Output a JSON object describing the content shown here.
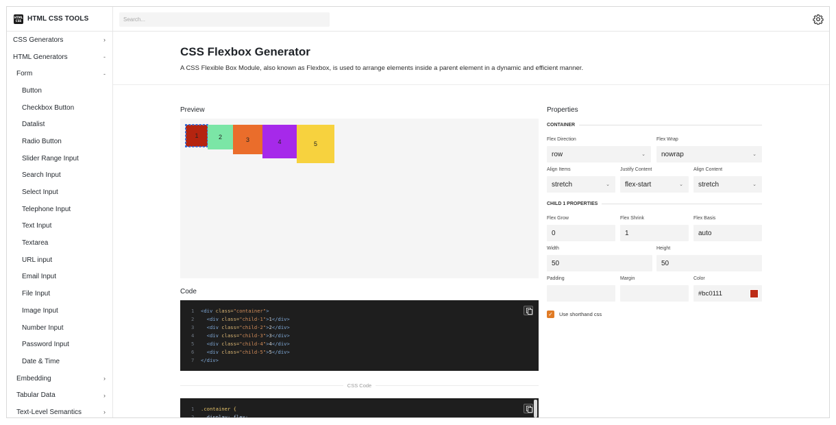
{
  "app": {
    "logo_badge": "HTML CSS",
    "logo_text": "HTML CSS TOOLS"
  },
  "search": {
    "placeholder": "Search..."
  },
  "icons": {
    "settings": "gear-icon",
    "copy": "copy-icon",
    "chevron": "chevron-down-icon",
    "check": "check-icon"
  },
  "sidebar": {
    "items": [
      {
        "label": "CSS Generators",
        "mark": "›",
        "level": 0
      },
      {
        "label": "HTML Generators",
        "mark": "-",
        "level": 0
      },
      {
        "label": "Form",
        "mark": "-",
        "level": 1
      },
      {
        "label": "Button",
        "mark": "",
        "level": 2
      },
      {
        "label": "Checkbox Button",
        "mark": "",
        "level": 2
      },
      {
        "label": "Datalist",
        "mark": "",
        "level": 2
      },
      {
        "label": "Radio Button",
        "mark": "",
        "level": 2
      },
      {
        "label": "Slider Range Input",
        "mark": "",
        "level": 2
      },
      {
        "label": "Search Input",
        "mark": "",
        "level": 2
      },
      {
        "label": "Select Input",
        "mark": "",
        "level": 2
      },
      {
        "label": "Telephone Input",
        "mark": "",
        "level": 2
      },
      {
        "label": "Text Input",
        "mark": "",
        "level": 2
      },
      {
        "label": "Textarea",
        "mark": "",
        "level": 2
      },
      {
        "label": "URL input",
        "mark": "",
        "level": 2
      },
      {
        "label": "Email Input",
        "mark": "",
        "level": 2
      },
      {
        "label": "File Input",
        "mark": "",
        "level": 2
      },
      {
        "label": "Image Input",
        "mark": "",
        "level": 2
      },
      {
        "label": "Number Input",
        "mark": "",
        "level": 2
      },
      {
        "label": "Password Input",
        "mark": "",
        "level": 2
      },
      {
        "label": "Date & Time",
        "mark": "",
        "level": 2
      },
      {
        "label": "Embedding",
        "mark": "›",
        "level": 1
      },
      {
        "label": "Tabular Data",
        "mark": "›",
        "level": 1
      },
      {
        "label": "Text-Level Semantics",
        "mark": "›",
        "level": 1
      }
    ]
  },
  "header": {
    "title": "CSS Flexbox Generator",
    "subtitle": "A CSS Flexible Box Module, also known as Flexbox, is used to arrange elements inside a parent element in a dynamic and efficient manner."
  },
  "preview": {
    "label": "Preview",
    "children": [
      "1",
      "2",
      "3",
      "4",
      "5"
    ]
  },
  "code": {
    "label": "Code",
    "html_lines": [
      {
        "n": "1",
        "indent": "",
        "open": "<div ",
        "attr": "class=",
        "val": "\"container\"",
        "close": ">",
        "text": "",
        "end": ""
      },
      {
        "n": "2",
        "indent": "  ",
        "open": "<div ",
        "attr": "class=",
        "val": "\"child-1\"",
        "close": ">",
        "text": "1",
        "end": "</div>"
      },
      {
        "n": "3",
        "indent": "  ",
        "open": "<div ",
        "attr": "class=",
        "val": "\"child-2\"",
        "close": ">",
        "text": "2",
        "end": "</div>"
      },
      {
        "n": "4",
        "indent": "  ",
        "open": "<div ",
        "attr": "class=",
        "val": "\"child-3\"",
        "close": ">",
        "text": "3",
        "end": "</div>"
      },
      {
        "n": "5",
        "indent": "  ",
        "open": "<div ",
        "attr": "class=",
        "val": "\"child-4\"",
        "close": ">",
        "text": "4",
        "end": "</div>"
      },
      {
        "n": "6",
        "indent": "  ",
        "open": "<div ",
        "attr": "class=",
        "val": "\"child-5\"",
        "close": ">",
        "text": "5",
        "end": "</div>"
      },
      {
        "n": "7",
        "indent": "",
        "open": "</div>",
        "attr": "",
        "val": "",
        "close": "",
        "text": "",
        "end": ""
      }
    ],
    "css_divider": "CSS Code",
    "css_lines": [
      {
        "n": "1",
        "sel": ".container {",
        "prop": ""
      },
      {
        "n": "2",
        "sel": "",
        "prop": "  display: flex;"
      }
    ]
  },
  "properties": {
    "title": "Properties",
    "container_head": "CONTAINER",
    "flex_direction": {
      "label": "Flex Direction",
      "value": "row"
    },
    "flex_wrap": {
      "label": "Flex Wrap",
      "value": "nowrap"
    },
    "align_items": {
      "label": "Align Items",
      "value": "stretch"
    },
    "justify_content": {
      "label": "Justify Content",
      "value": "flex-start"
    },
    "align_content": {
      "label": "Align Content",
      "value": "stretch"
    },
    "child_head": "CHILD 1 PROPERTIES",
    "flex_grow": {
      "label": "Flex Grow",
      "value": "0"
    },
    "flex_shrink": {
      "label": "Flex Shrink",
      "value": "1"
    },
    "flex_basis": {
      "label": "Flex Basis",
      "value": "auto"
    },
    "width": {
      "label": "Width",
      "value": "50"
    },
    "height": {
      "label": "Height",
      "value": "50"
    },
    "padding": {
      "label": "Padding",
      "value": ""
    },
    "margin": {
      "label": "Margin",
      "value": ""
    },
    "color": {
      "label": "Color",
      "value": "#bc0111",
      "swatch": "#bc2d17"
    },
    "shorthand": {
      "label": "Use shorthand css",
      "checked": true
    }
  },
  "colors": {
    "accent": "#e07b25",
    "code_bg": "#1e1e1e"
  }
}
